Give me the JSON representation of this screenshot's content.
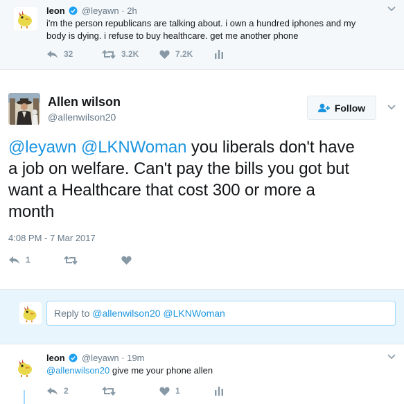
{
  "top_tweet": {
    "name": "leon",
    "handle": "@leyawn",
    "time": "· 2h",
    "text_line1": "i'm the person republicans are talking about. i own a hundred iphones and my",
    "text_line2": "body is dying. i refuse to buy healthcare. get me another phone",
    "replies": "32",
    "retweets": "3.2K",
    "likes": "7.2K"
  },
  "main_tweet": {
    "name": "Allen wilson",
    "handle": "@allenwilson20",
    "follow_label": "Follow",
    "mention1": "@leyawn",
    "mention2": "@LKNWoman",
    "text_line1_rest": " you liberals don't have",
    "text_line2": "a job on welfare. Can't pay the bills you got but",
    "text_line3": "want a Healthcare that cost 300 or more a",
    "text_line4": "month",
    "timestamp": "4:08 PM - 7 Mar 2017",
    "replies": "1"
  },
  "reply_box": {
    "prefix": "Reply to ",
    "mentions": "@allenwilson20 @LKNWoman"
  },
  "reply_tweet": {
    "name": "leon",
    "handle": "@leyawn",
    "time": "· 19m",
    "mention": "@allenwilson20",
    "text_rest": " give me your phone allen",
    "replies": "2",
    "likes": "1"
  },
  "colors": {
    "accent": "#1b95e0",
    "muted": "#657786",
    "icon_gray": "#8899a6",
    "reply_bg": "#e8f5fd"
  }
}
